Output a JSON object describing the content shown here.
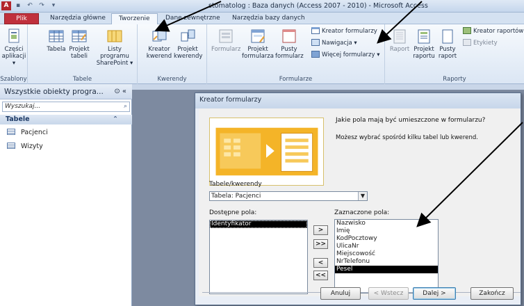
{
  "titlebar": {
    "app_icon_letter": "A",
    "title": "stomatolog : Baza danych (Access 2007 - 2010) - Microsoft Access"
  },
  "tabs": [
    {
      "label": "Plik"
    },
    {
      "label": "Narzędzia główne"
    },
    {
      "label": "Tworzenie"
    },
    {
      "label": "Dane zewnętrzne"
    },
    {
      "label": "Narzędzia bazy danych"
    }
  ],
  "ribbon": {
    "szablony": {
      "btn_line1": "Części",
      "btn_line2": "aplikacji ▾",
      "label": "Szablony"
    },
    "tabele": {
      "tabela": "Tabela",
      "projekt1": "Projekt",
      "projekt2": "tabeli",
      "listy1": "Listy programu",
      "listy2": "SharePoint ▾",
      "label": "Tabele"
    },
    "kwerendy": {
      "kreator1": "Kreator",
      "kreator2": "kwerend",
      "projekt1": "Projekt",
      "projekt2": "kwerendy",
      "label": "Kwerendy"
    },
    "formularze": {
      "formularz": "Formularz",
      "projekt1": "Projekt",
      "projekt2": "formularza",
      "pusty1": "Pusty",
      "pusty2": "formularz",
      "kreator": "Kreator formularzy",
      "nawigacja": "Nawigacja ▾",
      "wiecej": "Więcej formularzy ▾",
      "label": "Formularze"
    },
    "raporty": {
      "raport": "Raport",
      "projekt1": "Projekt",
      "projekt2": "raportu",
      "pusty1": "Pusty",
      "pusty2": "raport",
      "kreator": "Kreator raportów",
      "etykiety": "Etykiety",
      "label": "Raporty"
    }
  },
  "navpane": {
    "header": "Wszystkie obiekty progra...",
    "header_controls": "⊙ «",
    "search_placeholder": "Wyszukaj...",
    "group": "Tabele",
    "group_chevron": "⌃",
    "items": [
      {
        "label": "Pacjenci"
      },
      {
        "label": "Wizyty"
      }
    ]
  },
  "dialog": {
    "title": "Kreator formularzy",
    "question": "Jakie pola mają być umieszczone w formularzu?",
    "hint": "Możesz wybrać spośród kilku tabel lub kwerend.",
    "table_label": "Tabele/kwerendy",
    "table_value": "Tabela: Pacjenci",
    "available_label": "Dostępne pola:",
    "selected_label": "Zaznaczone pola:",
    "available_fields": [
      "Identyfikator"
    ],
    "selected_fields": [
      "Nazwisko",
      "Imię",
      "KodPocztowy",
      "UlicaNr",
      "Miejscowość",
      "NrTelefonu",
      "Pesel"
    ],
    "move_buttons": [
      ">",
      ">>",
      "<",
      "<<"
    ],
    "buttons": {
      "cancel": "Anuluj",
      "back": "< Wstecz",
      "next": "Dalej >",
      "finish": "Zakończ"
    }
  },
  "colors": {
    "file_tab": "#c0303c",
    "workspace": "#7d8aa0",
    "dialog_art": "#f0a81e"
  }
}
